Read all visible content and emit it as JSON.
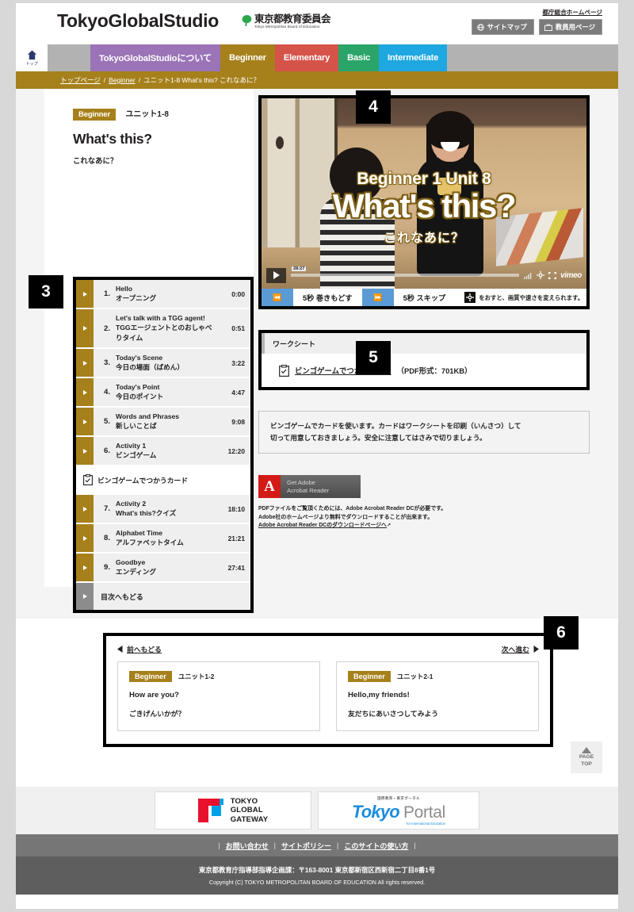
{
  "header": {
    "logo": "TokyoGlobalStudio",
    "board_jp": "東京都教育委員会",
    "board_en": "Tokyo Metropolitan Board of Education",
    "metro_link": "都庁総合ホームページ",
    "sitemap_button": "サイトマップ",
    "teacher_button": "教員用ページ"
  },
  "nav": {
    "home_label": "トップ",
    "items": [
      {
        "label": "TokyoGlobalStudioについて",
        "color": "#9b74b8"
      },
      {
        "label": "Beginner",
        "color": "#a6801b"
      },
      {
        "label": "Elementary",
        "color": "#d6534a"
      },
      {
        "label": "Basic",
        "color": "#2ba46a"
      },
      {
        "label": "Intermediate",
        "color": "#1ea7e0"
      }
    ]
  },
  "breadcrumb": {
    "item1": "トップページ",
    "item2": "Beginner",
    "item3": "ユニット1-8 What's this? これなあに？",
    "separator": "/"
  },
  "title": {
    "badge": "Beginner",
    "unit": "ユニット1-8",
    "english": "What's this?",
    "japanese": "これなあに？"
  },
  "chapters": [
    {
      "num": "1.",
      "en": "Hello",
      "ja": "オープニング",
      "time": "0:00"
    },
    {
      "num": "2.",
      "en": "Let's talk with a TGG agent!",
      "ja": "TGGエージェントとのおしゃべりタイム",
      "time": "0:51"
    },
    {
      "num": "3.",
      "en": "Today's Scene",
      "ja": "今日の場面（ばめん）",
      "time": "3:22"
    },
    {
      "num": "4.",
      "en": "Today's Point",
      "ja": "今日のポイント",
      "time": "4:47"
    },
    {
      "num": "5.",
      "en": "Words and Phrases",
      "ja": "新しいことば",
      "time": "9:08"
    },
    {
      "num": "6.",
      "en": "Activity 1",
      "ja": "ビンゴゲーム",
      "time": "12:20"
    },
    {
      "num": "7.",
      "en": "Activity 2",
      "ja": "What's this?クイズ",
      "time": "18:10"
    },
    {
      "num": "8.",
      "en": "Alphabet Time",
      "ja": "アルファベットタイム",
      "time": "21:21"
    },
    {
      "num": "9.",
      "en": "Goodbye",
      "ja": "エンディング",
      "time": "27:41"
    }
  ],
  "chapter_worksheet_row": "ビンゴゲームでつかうカード",
  "chapter_back": "目次へもどる",
  "video": {
    "overlay_line1": "Beginner 1 Unit 8",
    "overlay_line2": "What's this?",
    "overlay_line3": "これなあに？",
    "duration": "28:27",
    "player_brand": "vimeo"
  },
  "video_controls": {
    "rewind_icon": "⏪",
    "rewind_label": "5秒 巻きもどす",
    "forward_icon": "⏩",
    "forward_label": "5秒 スキップ",
    "gear_note": "をおすと、画質や速さを変えられます。"
  },
  "worksheet": {
    "heading": "ワークシート",
    "link": "ビンゴゲームでつかうカード",
    "filesize": "（PDF形式：701KB）"
  },
  "note": {
    "line1": "ビンゴゲームでカードを使います。カードはワークシートを印刷（いんさつ）して",
    "line2": "切って用意しておきましょう。安全に注意してはさみで切りましょう。"
  },
  "adobe": {
    "button_line1": "Get Adobe",
    "button_line2": "Acrobat Reader",
    "text1": "PDFファイルをご覧頂くためには、Adobe Acrobat Reader DCが必要です。",
    "text2": "Adobe社のホームページより無料でダウンロードすることが出来ます。",
    "link": "Adobe Acrobat Reader DCのダウンロードページへ"
  },
  "pagination": {
    "prev_label": "前へもどる",
    "next_label": "次へ進む",
    "prev_card": {
      "badge": "Beginner",
      "unit": "ユニット1-2",
      "en": "How are you?",
      "ja": "ごきげんいかが？"
    },
    "next_card": {
      "badge": "Beginner",
      "unit": "ユニット2-1",
      "en": "Hello,my friends!",
      "ja": "友だちにあいさつしてみよう"
    }
  },
  "page_top": {
    "line1": "PAGE",
    "line2": "TOP"
  },
  "footer": {
    "logo1_l1": "TOKYO",
    "logo1_l2": "GLOBAL",
    "logo1_l3": "GATEWAY",
    "logo2_small": "国際教育・東京ポータル",
    "logo2_k": "Tokyo",
    "logo2_p": "Portal",
    "logo2_sub": "for International Education",
    "links": [
      "お問い合わせ",
      "サイトポリシー",
      "このサイトの使い方"
    ],
    "address": "東京都教育庁指導部指導企画課：〒163-8001 東京都新宿区西新宿二丁目8番1号",
    "copyright": "Copyright (C) TOKYO METROPOLITAN BOARD OF EDUCATION All rights reserved."
  },
  "annotations": [
    {
      "id": "3",
      "label": "3"
    },
    {
      "id": "4",
      "label": "4"
    },
    {
      "id": "5",
      "label": "5"
    },
    {
      "id": "6",
      "label": "6"
    }
  ]
}
